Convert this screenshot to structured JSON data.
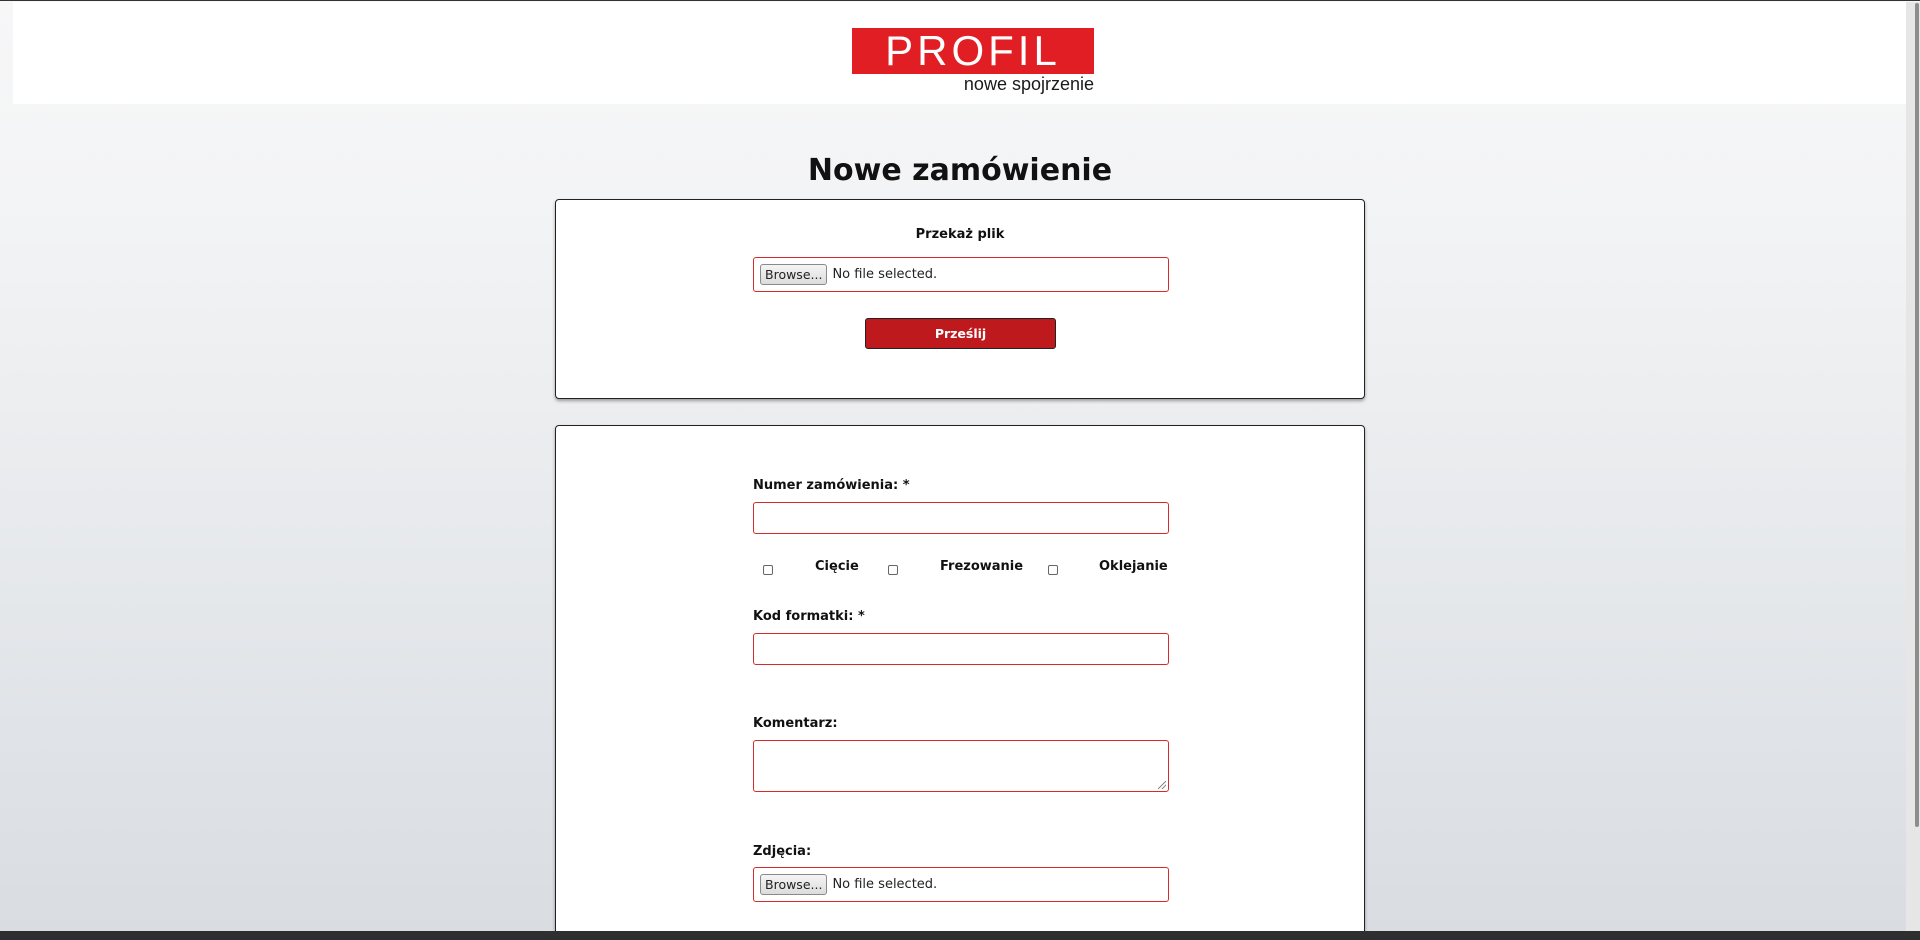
{
  "logo": {
    "brand": "PROFIL",
    "tagline": "nowe spojrzenie"
  },
  "page_title": "Nowe zamówienie",
  "upload_section": {
    "label": "Przekaż plik",
    "browse_label": "Browse...",
    "file_status": "No file selected.",
    "submit_label": "Prześlij"
  },
  "order_form": {
    "order_number_label": "Numer zamówienia: *",
    "order_number_value": "",
    "options": [
      {
        "label": "Cięcie",
        "checked": false
      },
      {
        "label": "Frezowanie",
        "checked": false
      },
      {
        "label": "Oklejanie",
        "checked": false
      }
    ],
    "format_code_label": "Kod formatki: *",
    "format_code_value": "",
    "comment_label": "Komentarz:",
    "comment_value": "",
    "photos_label": "Zdjęcia:",
    "photos_browse_label": "Browse...",
    "photos_file_status": "No file selected."
  },
  "colors": {
    "brand_red": "#e01e23",
    "button_red": "#be1a1e",
    "input_border": "#d72a2a"
  }
}
